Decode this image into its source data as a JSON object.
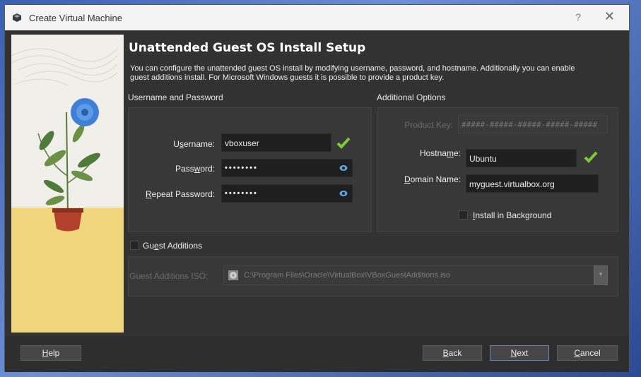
{
  "window": {
    "title": "Create Virtual Machine",
    "help_glyph": "?",
    "close_glyph": "✕"
  },
  "heading": "Unattended Guest OS Install Setup",
  "description": "You can configure the unattended guest OS install by modifying username, password, and hostname. Additionally you can enable guest additions install. For Microsoft Windows guests it is possible to provide a product key.",
  "username_section": {
    "title": "Username and Password",
    "username_label_pre": "U",
    "username_label_u": "s",
    "username_label_post": "ername:",
    "username_value": "vboxuser",
    "password_label_pre": "Pass",
    "password_label_u": "w",
    "password_label_post": "ord:",
    "password_value": "••••••••",
    "repeat_label_pre": "",
    "repeat_label_u": "R",
    "repeat_label_post": "epeat Password:",
    "repeat_value": "••••••••"
  },
  "options_section": {
    "title": "Additional Options",
    "product_key_label": "Product Key:",
    "product_key_placeholder": "#####-#####-#####-#####-#####",
    "hostname_label_pre": "Hostna",
    "hostname_label_u": "m",
    "hostname_label_post": "e:",
    "hostname_value": "Ubuntu",
    "domain_label_pre": "",
    "domain_label_u": "D",
    "domain_label_post": "omain Name:",
    "domain_value": "myguest.virtualbox.org",
    "install_bg_pre": "",
    "install_bg_u": "I",
    "install_bg_post": "nstall in Background",
    "install_bg_checked": false
  },
  "guest_additions": {
    "label_pre": "Gu",
    "label_u": "e",
    "label_post": "st Additions",
    "checked": false,
    "iso_label": "Guest Additions ISO:",
    "iso_path": "C:\\Program Files\\Oracle\\VirtualBox\\VBoxGuestAdditions.iso"
  },
  "buttons": {
    "help_u": "H",
    "help_rest": "elp",
    "back_u": "B",
    "back_rest": "ack",
    "next_u": "N",
    "next_rest": "ext",
    "cancel_u": "C",
    "cancel_rest": "ancel"
  },
  "colors": {
    "valid_check": "#7cc93a",
    "eye_icon": "#5fa3e0",
    "accent_border": "#6b82b8"
  }
}
